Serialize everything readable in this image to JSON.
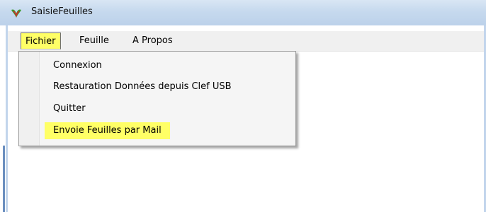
{
  "window": {
    "title": "SaisieFeuilles",
    "icon": "green-red-app-icon"
  },
  "menubar": {
    "items": [
      {
        "label": "Fichier",
        "active": true
      },
      {
        "label": "Feuille",
        "active": false
      },
      {
        "label": "A Propos",
        "active": false
      }
    ]
  },
  "dropdown": {
    "items": [
      {
        "label": "Connexion",
        "highlighted": false
      },
      {
        "label": "Restauration Données depuis Clef USB",
        "highlighted": false
      },
      {
        "label": "Quitter",
        "highlighted": false
      },
      {
        "label": "Envoie Feuilles par Mail",
        "highlighted": true
      }
    ]
  },
  "colors": {
    "highlight": "#ffff66",
    "titlebar": "#c6d9ee"
  }
}
